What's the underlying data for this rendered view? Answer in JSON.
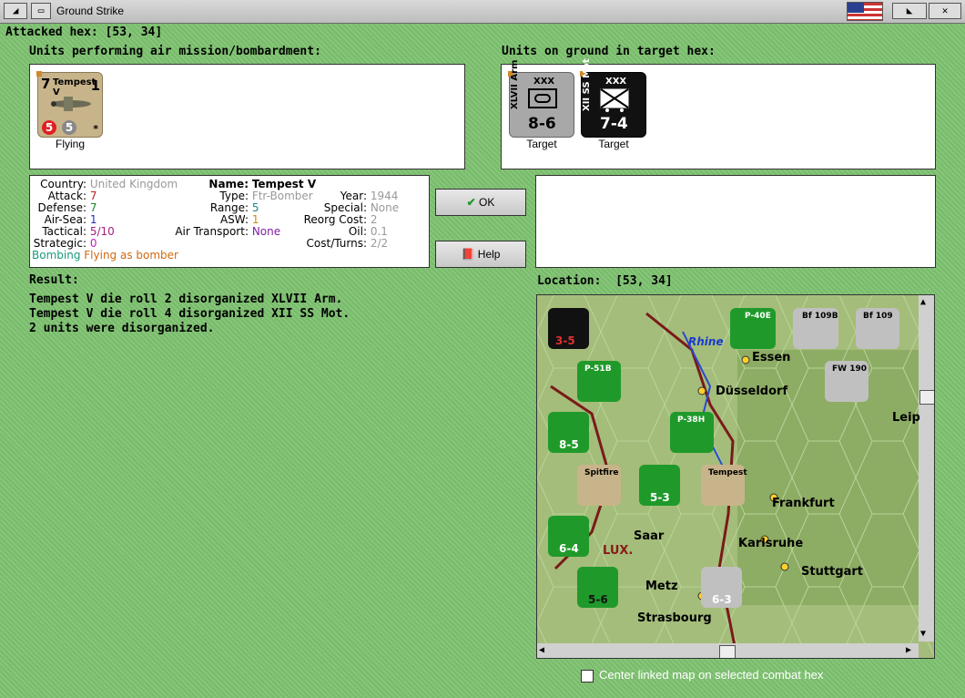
{
  "window": {
    "title": "Ground Strike"
  },
  "header": {
    "attacked_hex_label": "Attacked hex:",
    "attacked_hex_value": "[53, 34]"
  },
  "air_units": {
    "label": "Units performing air mission/bombardment:",
    "units": [
      {
        "name": "Tempest V",
        "attack": "7",
        "defense": "1",
        "tactical_badge": "5",
        "strategic_badge": "5",
        "caption": "Flying"
      }
    ]
  },
  "ground_units": {
    "label": "Units on ground in target hex:",
    "units": [
      {
        "corps": "XLVII Arm",
        "size": "XXX",
        "strength": "8-6",
        "caption": "Target",
        "bg": "#a8a8a8"
      },
      {
        "corps": "XII SS Mot",
        "size": "XXX",
        "strength": "7-4",
        "caption": "Target",
        "bg": "#111111"
      }
    ]
  },
  "unit_info": {
    "country_label": "Country:",
    "country": "United Kingdom",
    "attack_label": "Attack:",
    "attack": "7",
    "defense_label": "Defense:",
    "defense": "7",
    "airsea_label": "Air-Sea:",
    "airsea": "1",
    "tactical_label": "Tactical:",
    "tactical": "5/10",
    "strategic_label": "Strategic:",
    "strategic": "0",
    "mode_a": "Bombing",
    "mode_b": "Flying as bomber",
    "name_label": "Name:",
    "name": "Tempest V",
    "type_label": "Type:",
    "type": "Ftr-Bomber",
    "range_label": "Range:",
    "range": "5",
    "asw_label": "ASW:",
    "asw": "1",
    "airtransport_label": "Air Transport:",
    "airtransport": "None",
    "year_label": "Year:",
    "year": "1944",
    "special_label": "Special:",
    "special": "None",
    "reorg_label": "Reorg Cost:",
    "reorg": "2",
    "oil_label": "Oil:",
    "oil": "0.1",
    "cost_label": "Cost/Turns:",
    "cost": "2/2"
  },
  "buttons": {
    "ok": "OK",
    "help": "Help"
  },
  "result": {
    "label": "Result:",
    "lines": [
      "Tempest V die roll 2 disorganized XLVII Arm.",
      "Tempest V die roll 4 disorganized XII SS Mot.",
      "2 units were disorganized."
    ]
  },
  "location": {
    "label": "Location:",
    "value": "[53, 34]"
  },
  "map": {
    "cities": [
      "Essen",
      "Düsseldorf",
      "Frankfurt",
      "Karlsruhe",
      "Stuttgart",
      "Metz",
      "Strasbourg",
      "Leip",
      "Saar",
      "LUX.",
      "Rhine"
    ],
    "counters": [
      {
        "label": "3-5"
      },
      {
        "label": "8-5"
      },
      {
        "label": "5-3"
      },
      {
        "label": "6-4"
      },
      {
        "label": "5-6"
      },
      {
        "label": "6-3"
      },
      {
        "label": "P-40E"
      },
      {
        "label": "Bf 109B"
      },
      {
        "label": "Bf 109"
      },
      {
        "label": "FW 190"
      },
      {
        "label": "P-51B"
      },
      {
        "label": "P-38H"
      },
      {
        "label": "Spitfire"
      },
      {
        "label": "Tempest"
      }
    ]
  },
  "footer": {
    "center_checkbox_label": "Center linked map on selected combat hex",
    "center_checkbox_checked": false
  },
  "colors": {
    "background": "#7fbf72",
    "us_green": "#1f9a2a",
    "german_grey": "#a8a8a8",
    "ss_black": "#111111",
    "uk_tan": "#c8b48a"
  }
}
